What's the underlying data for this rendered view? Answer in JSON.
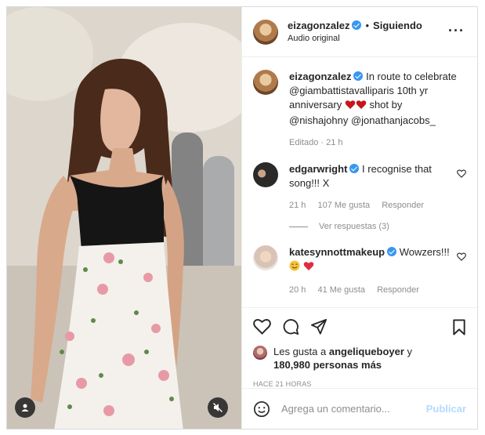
{
  "header": {
    "username": "eizagonzalez",
    "follow_label": "Siguiendo",
    "dot": "•",
    "audio": "Audio original",
    "more_icon": "more-options-icon"
  },
  "caption": {
    "username": "eizagonzalez",
    "text_1": "In route to celebrate",
    "line_2": "@giambattistavalliparis 10th yr",
    "line_3_a": "anniversary",
    "line_3_b": "shot by",
    "line_4": "@nishajohny @jonathanjacobs_",
    "edited": "Editado · 21 h"
  },
  "comments": [
    {
      "username": "edgarwright",
      "text_1": "I recognise that",
      "text_2": "song!!! X",
      "time": "21 h",
      "likes": "107 Me gusta",
      "reply": "Responder",
      "view_replies": "Ver respuestas (3)"
    },
    {
      "username": "katesynnottmakeup",
      "text_1": "Wowzers!!!",
      "time": "20 h",
      "likes": "41 Me gusta",
      "reply": "Responder"
    }
  ],
  "likes": {
    "prefix": "Les gusta a",
    "user": "angeliqueboyer",
    "conj": "y",
    "count": "180,980 personas más"
  },
  "timestamp": "HACE 21 HORAS",
  "composer": {
    "placeholder": "Agrega un comentario...",
    "publish": "Publicar"
  },
  "colors": {
    "verified": "#3897f0",
    "publish_disabled": "#b3dbff",
    "heart": "#e02c3c"
  }
}
